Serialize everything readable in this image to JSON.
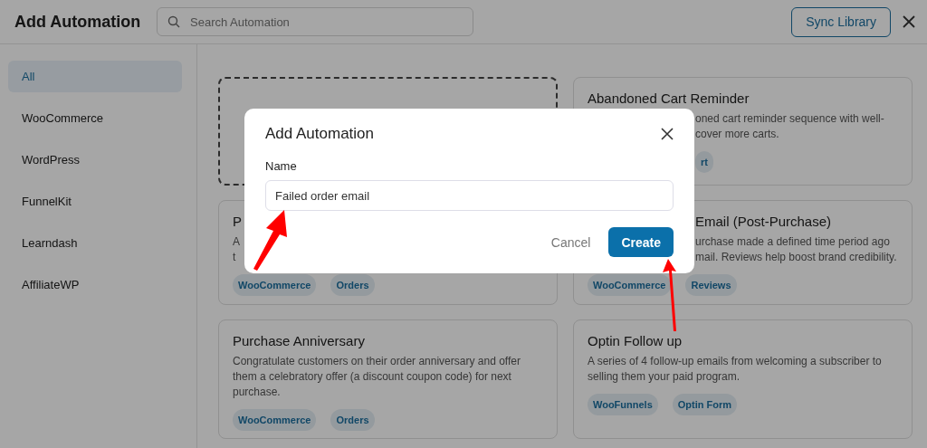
{
  "header": {
    "title": "Add Automation",
    "search": {
      "placeholder": "Search Automation"
    },
    "sync_button": "Sync Library"
  },
  "sidebar": {
    "items": [
      {
        "label": "All",
        "selected": true
      },
      {
        "label": "WooCommerce",
        "selected": false
      },
      {
        "label": "WordPress",
        "selected": false
      },
      {
        "label": "FunnelKit",
        "selected": false
      },
      {
        "label": "Learndash",
        "selected": false
      },
      {
        "label": "AffiliateWP",
        "selected": false
      }
    ]
  },
  "cards": [
    {
      "kind": "empty"
    },
    {
      "kind": "top_right",
      "title": "Abandoned Cart Reminder",
      "description": [
        "oned cart reminder sequence with well-",
        "cover more carts."
      ],
      "tags": [
        "rt"
      ]
    },
    {
      "kind": "mid_left",
      "title": "P",
      "description": [
        "A",
        "t"
      ],
      "tags": [
        "WooCommerce",
        "Orders"
      ]
    },
    {
      "kind": "mid_right",
      "title": "Email (Post-Purchase)",
      "description": [
        "urchase made a defined time period ago",
        "mail. Reviews help boost brand credibility."
      ],
      "tags": [
        "WooCommerce",
        "Reviews"
      ]
    },
    {
      "kind": "full",
      "title": "Purchase Anniversary",
      "description": [
        "Congratulate customers on their order anniversary and offer them a celebratory offer (a discount coupon code) for next purchase."
      ],
      "tags": [
        "WooCommerce",
        "Orders"
      ]
    },
    {
      "kind": "full",
      "title": "Optin Follow up",
      "description": [
        "A series of 4 follow-up emails from welcoming a subscriber to selling them your paid program."
      ],
      "tags": [
        "WooFunnels",
        "Optin Form"
      ]
    }
  ],
  "modal": {
    "title": "Add Automation",
    "field_label": "Name",
    "field_value": "Failed order email",
    "cancel": "Cancel",
    "create": "Create"
  }
}
